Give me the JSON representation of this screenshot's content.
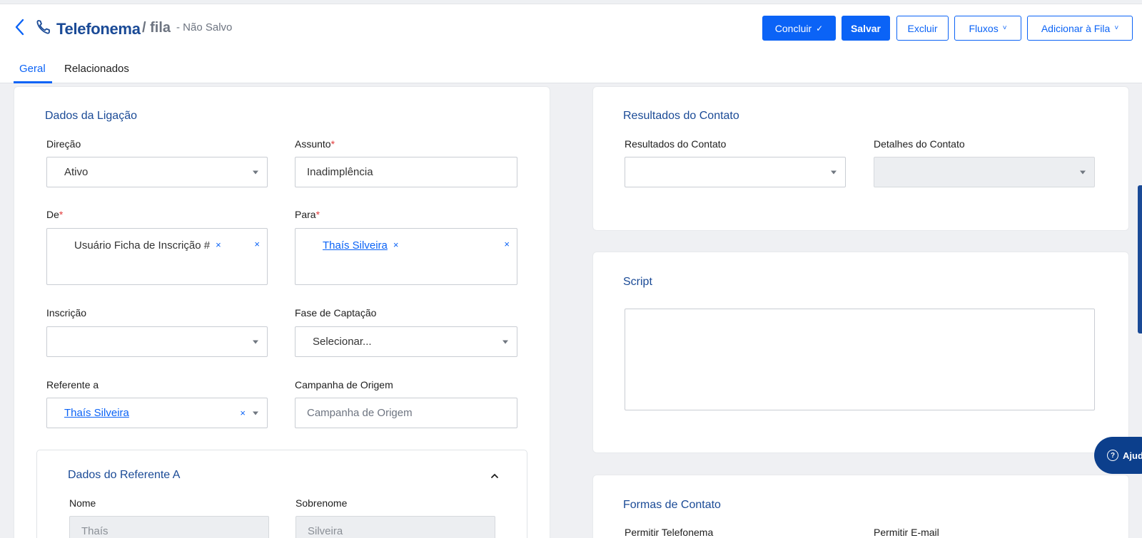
{
  "header": {
    "title": "Telefonema",
    "subtitle": "/ fila",
    "status": "- Não Salvo"
  },
  "toolbar": {
    "concluir": "Concluir",
    "concluir_icon": "✓",
    "salvar": "Salvar",
    "excluir": "Excluir",
    "fluxos": "Fluxos",
    "adicionar": "Adicionar à Fila",
    "chevron": "˅"
  },
  "tabs": [
    {
      "label": "Geral"
    },
    {
      "label": "Relacionados"
    }
  ],
  "dados_ligacao": {
    "title": "Dados da Ligação",
    "direcao_label": "Direção",
    "direcao_value": "Ativo",
    "assunto_label": "Assunto",
    "assunto_value": "Inadimplência",
    "de_label": "De",
    "de_value": "Usuário Ficha de Inscrição #",
    "para_label": "Para",
    "para_value": "Thaís Silveira",
    "inscricao_label": "Inscrição",
    "fase_label": "Fase de Captação",
    "fase_value": "Selecionar...",
    "referente_label": "Referente a",
    "referente_value": "Thaís Silveira",
    "campanha_label": "Campanha de Origem",
    "campanha_placeholder": "Campanha de Origem",
    "required_mark": "*",
    "remove_mark": "×"
  },
  "dados_referente": {
    "title": "Dados do Referente A",
    "nome_label": "Nome",
    "nome_value": "Thaís",
    "sobrenome_label": "Sobrenome",
    "sobrenome_value": "Silveira"
  },
  "resultados": {
    "title": "Resultados do Contato",
    "resultados_label": "Resultados do Contato",
    "detalhes_label": "Detalhes do Contato"
  },
  "script": {
    "title": "Script"
  },
  "formas_contato": {
    "title": "Formas de Contato",
    "telefonema_label": "Permitir Telefonema",
    "email_label": "Permitir E-mail"
  },
  "help": {
    "label": "Ajud",
    "icon": "?"
  },
  "colors": {
    "primary": "#0b63f6",
    "title_blue": "#1a4a96",
    "required": "#e23b3b"
  }
}
